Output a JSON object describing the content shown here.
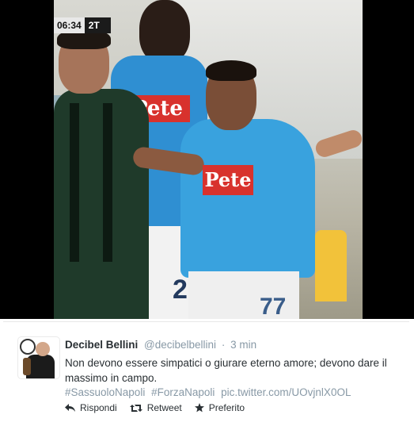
{
  "media": {
    "scoreboard": {
      "time": "06:34",
      "half": "2T"
    },
    "sponsor_text": "Pete",
    "jersey_numbers": [
      "26",
      "77"
    ]
  },
  "tweet": {
    "author_name": "Decibel Bellini",
    "author_handle": "@decibelbellini",
    "separator": "·",
    "timestamp": "3 min",
    "text_line1": "Non devono essere simpatici o giurare eterno amore; devono dare il",
    "text_line2": "massimo in campo.",
    "hashtags": [
      "#SassuoloNapoli",
      "#ForzaNapoli"
    ],
    "pic_link": "pic.twitter.com/UOvjnlX0OL",
    "actions": {
      "reply": "Rispondi",
      "retweet": "Retweet",
      "favorite": "Preferito"
    },
    "colors": {
      "text": "#292f33",
      "muted": "#8899a6",
      "background": "#ffffff"
    },
    "icons": [
      "reply-icon",
      "retweet-icon",
      "star-icon"
    ]
  }
}
